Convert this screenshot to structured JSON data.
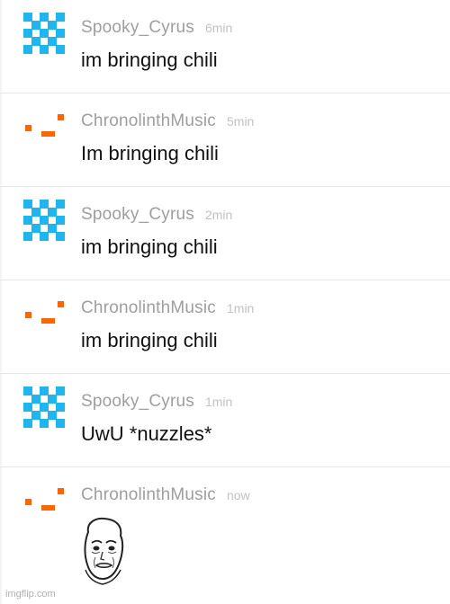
{
  "messages": [
    {
      "avatar": "blue-checker-avatar",
      "username": "Spooky_Cyrus",
      "time": "6min",
      "text": "im bringing chili"
    },
    {
      "avatar": "orange-blocks-avatar",
      "username": "ChronolinthMusic",
      "time": "5min",
      "text": "Im bringing chili"
    },
    {
      "avatar": "blue-checker-avatar",
      "username": "Spooky_Cyrus",
      "time": "2min",
      "text": "im bringing chili"
    },
    {
      "avatar": "orange-blocks-avatar",
      "username": "ChronolinthMusic",
      "time": "1min",
      "text": "im bringing chili"
    },
    {
      "avatar": "blue-checker-avatar",
      "username": "Spooky_Cyrus",
      "time": "1min",
      "text": "UwU *nuzzles*"
    },
    {
      "avatar": "orange-blocks-avatar",
      "username": "ChronolinthMusic",
      "time": "now",
      "text": "",
      "attachment": "okay-meme-face"
    }
  ],
  "colors": {
    "blue_avatar": "#1fb6f0",
    "orange_avatar": "#ff6600",
    "username": "#9e9e9e",
    "time": "#c2c2c2"
  },
  "watermark": "imgflip.com"
}
